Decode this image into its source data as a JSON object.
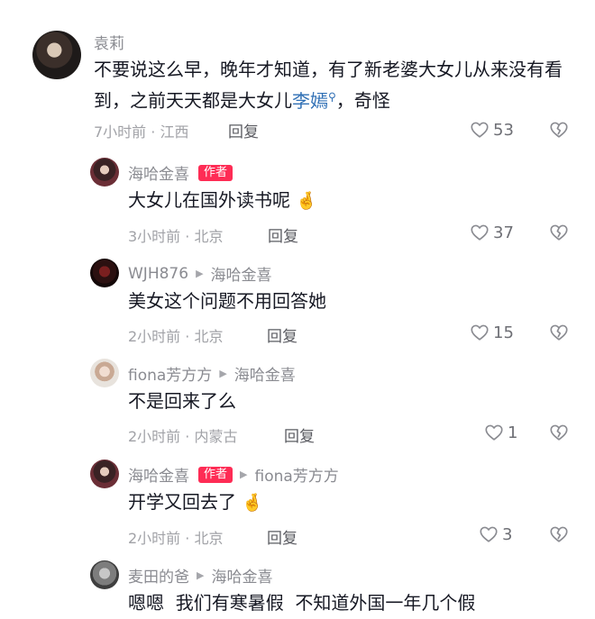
{
  "comments": [
    {
      "name": "袁莉",
      "text_before": "不要说这么早，晚年才知道，有了新老婆大女儿从来没有看到，之前天天都是大女儿",
      "highlight": "李嫣",
      "text_after": "，奇怪",
      "time_location": "7小时前 · 江西",
      "reply_label": "回复",
      "likes": "53"
    },
    {
      "name": "海哈金喜",
      "badge": "作者",
      "text": "大女儿在国外读书呢",
      "emoji": "🤞",
      "time_location": "3小时前 · 北京",
      "reply_label": "回复",
      "likes": "37"
    },
    {
      "name": "WJH876",
      "reply_to": "海哈金喜",
      "text": "美女这个问题不用回答她",
      "time_location": "2小时前 · 北京",
      "reply_label": "回复",
      "likes": "15"
    },
    {
      "name": "fiona芳方方",
      "reply_to": "海哈金喜",
      "text": "不是回来了么",
      "time_location": "2小时前 · 内蒙古",
      "reply_label": "回复",
      "likes": "1"
    },
    {
      "name": "海哈金喜",
      "badge": "作者",
      "reply_to": "fiona芳方方",
      "text": "开学又回去了",
      "emoji": "🤞",
      "time_location": "2小时前 · 北京",
      "reply_label": "回复",
      "likes": "3"
    },
    {
      "name": "麦田的爸",
      "reply_to": "海哈金喜",
      "text": "嗯嗯  我们有寒暑假  不知道外国一年几个假"
    }
  ],
  "icons": {
    "like": "heart-outline-icon",
    "dislike": "broken-heart-icon",
    "reply_arrow": "triangle-right-icon",
    "search_hint": "search-icon"
  },
  "colors": {
    "author_badge": "#fe2c55",
    "mention_link": "#2f6fb5",
    "meta_gray": "#a1a2a7"
  }
}
